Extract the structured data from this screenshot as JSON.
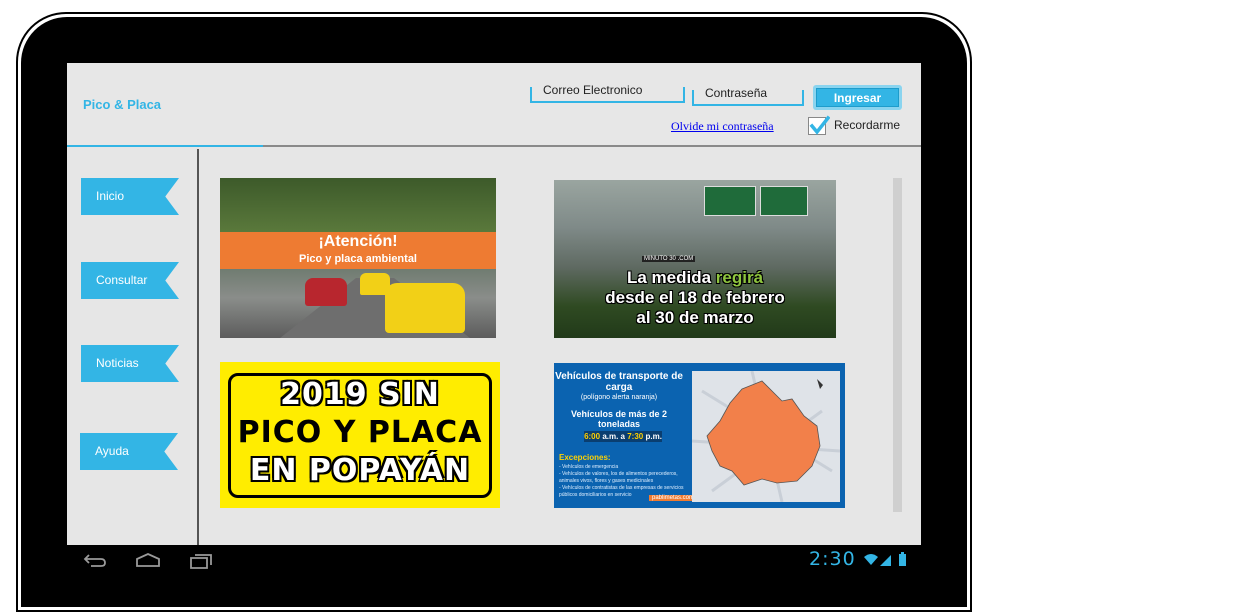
{
  "app": {
    "title": "Pico & Placa"
  },
  "login": {
    "email_label": "Correo Electronico",
    "password_label": "Contraseña",
    "submit_label": "Ingresar",
    "forgot_label": "Olvide mi contraseña",
    "remember_label": "Recordarme",
    "remember_checked": true
  },
  "nav": {
    "items": [
      {
        "label": "Inicio"
      },
      {
        "label": "Consultar"
      },
      {
        "label": "Noticias"
      },
      {
        "label": "Ayuda"
      }
    ]
  },
  "cards": [
    {
      "heading": "¡Atención!",
      "subheading": "Pico y placa ambiental"
    },
    {
      "line1_a": "La medida",
      "line1_b": "regirá",
      "line2": "desde el 18 de febrero",
      "line3": "al 30 de marzo",
      "brand": "MINUTO 30 .COM"
    },
    {
      "line1": "2019 SIN",
      "line2": "PICO Y PLACA",
      "line3": "EN POPAYÁN"
    },
    {
      "title": "Vehículos de transporte de carga",
      "subtitle": "(polígono alerta naranja)",
      "weight": "Vehículos de más de 2 toneladas",
      "hours_start": "6:00",
      "hours_sep": "a.m. a",
      "hours_end": "7:30",
      "hours_suffix": "p.m.",
      "exceptions_title": "Excepciones:",
      "exceptions": "- Vehículos de emergencia\n- Vehículos de valores, los de alimentos perecederos, animales vivos, flores y gases medicinales\n- Vehículos de contratistas de las empresas de servicios públicos domiciliarios en servicio",
      "brand": "pablimetas.com"
    }
  ],
  "system": {
    "clock": "2:30"
  },
  "colors": {
    "accent": "#33b5e5",
    "screen_bg": "#e6e6e6",
    "orange": "#ee7b32",
    "yellow": "#ffed00"
  }
}
